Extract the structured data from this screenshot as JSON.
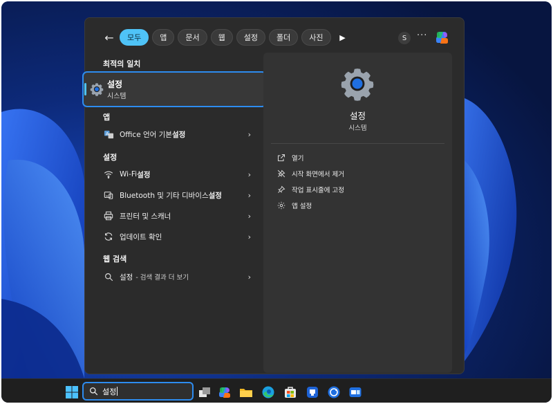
{
  "filters": {
    "back_icon": "back-arrow-icon",
    "chips": [
      "모두",
      "앱",
      "문서",
      "웹",
      "설정",
      "폴더",
      "사진"
    ],
    "active_index": 0,
    "next_icon": "play-icon",
    "account_initial": "S",
    "more_label": "···",
    "copilot_icon": "copilot-icon"
  },
  "left": {
    "best_match_header": "최적의 일치",
    "best_match": {
      "title": "설정",
      "subtitle": "시스템",
      "icon": "gear-icon"
    },
    "apps_header": "앱",
    "apps": [
      {
        "prefix": "Office 언어 기본 ",
        "bold": "설정",
        "icon": "office-language-icon"
      }
    ],
    "settings_header": "설정",
    "settings": [
      {
        "prefix": "Wi-Fi ",
        "bold": "설정",
        "icon": "wifi-icon"
      },
      {
        "prefix": "Bluetooth 및 기타 디바이스 ",
        "bold": "설정",
        "icon": "bluetooth-devices-icon"
      },
      {
        "prefix": "프린터 및 스캐너",
        "bold": "",
        "icon": "printer-icon"
      },
      {
        "prefix": "업데이트 확인",
        "bold": "",
        "icon": "update-icon"
      }
    ],
    "web_header": "웹 검색",
    "web": {
      "query": "설정",
      "suffix": "- 검색 결과 더 보기",
      "icon": "search-icon"
    }
  },
  "right": {
    "title": "설정",
    "subtitle": "시스템",
    "actions": [
      {
        "label": "열기",
        "icon": "open-icon"
      },
      {
        "label": "시작 화면에서 제거",
        "icon": "unpin-icon"
      },
      {
        "label": "작업 표시줄에 고정",
        "icon": "pin-icon"
      },
      {
        "label": "앱 설정",
        "icon": "gear-icon"
      }
    ]
  },
  "taskbar": {
    "search_value": "설정",
    "icons": [
      "start-icon",
      "task-view-icon",
      "copilot-icon",
      "file-explorer-icon",
      "edge-icon",
      "store-icon",
      "app-icon",
      "sync-icon",
      "remote-desktop-icon"
    ]
  },
  "colors": {
    "accent": "#2d8cf0",
    "chip_active": "#4fc3f7",
    "menu_bg": "#2b2b2b"
  }
}
